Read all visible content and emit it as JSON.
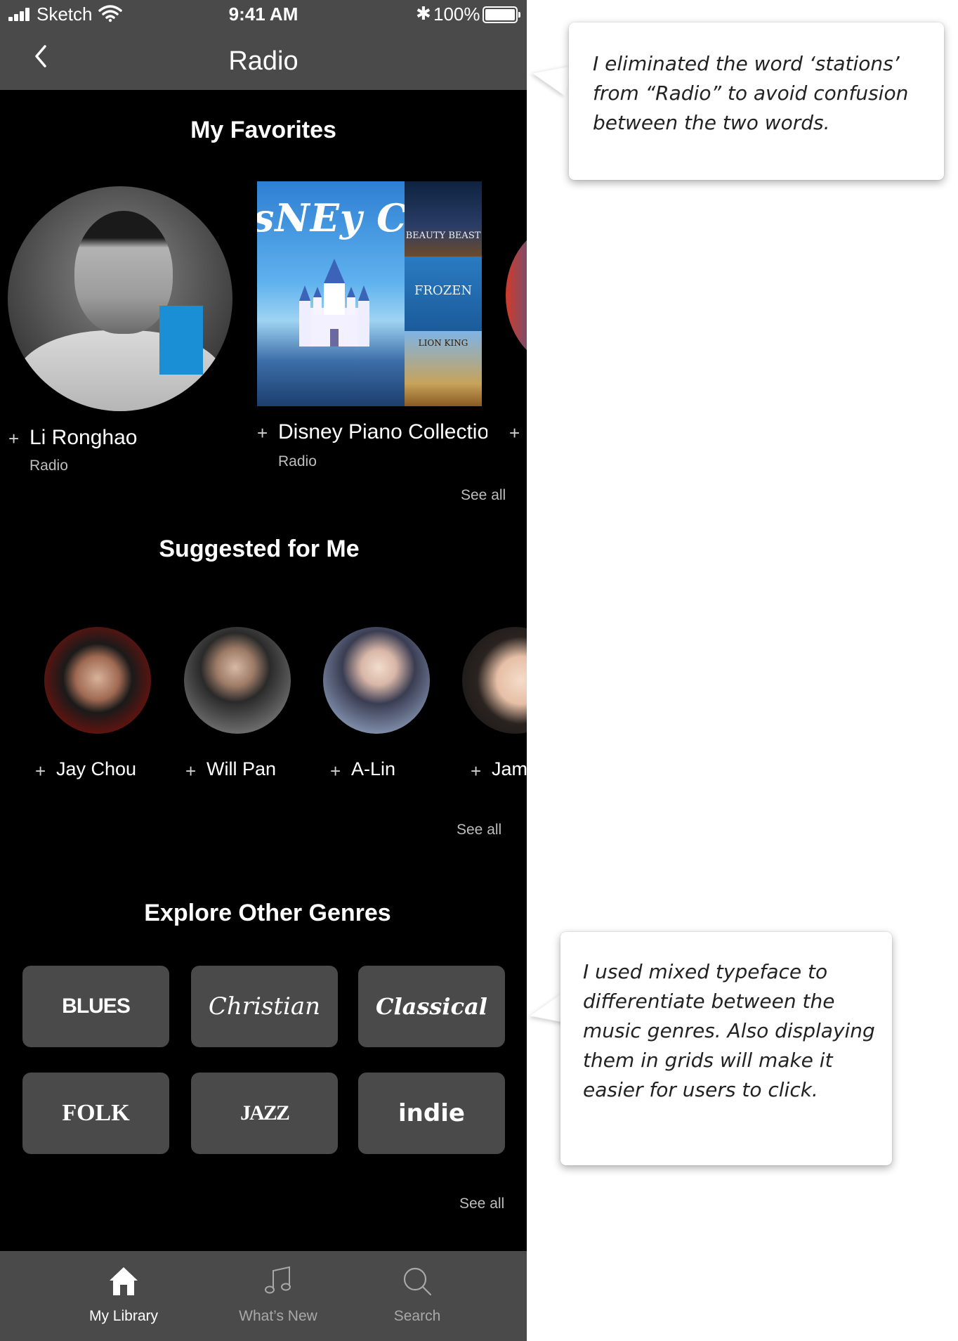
{
  "status_bar": {
    "carrier": "Sketch",
    "time": "9:41 AM",
    "battery": "100%"
  },
  "nav": {
    "title": "Radio"
  },
  "favorites": {
    "title": "My Favorites",
    "items": [
      {
        "name": "Li Ronghao",
        "subtitle": "Radio"
      },
      {
        "name": "Disney Piano Collection",
        "subtitle": "Radio"
      }
    ],
    "artwork_text": "sNEy CoLLE",
    "posters": [
      "BEAUTY BEAST",
      "FROZEN",
      "LION KING"
    ],
    "plus": "+",
    "see_all": "See all"
  },
  "suggested": {
    "title": "Suggested for Me",
    "items": [
      {
        "name": "Jay Chou"
      },
      {
        "name": "Will Pan"
      },
      {
        "name": "A-Lin"
      },
      {
        "name": "Jam"
      }
    ],
    "see_all": "See all"
  },
  "genres": {
    "title": "Explore Other Genres",
    "items": [
      "BLUES",
      "Christian",
      "Classical",
      "FOLK",
      "JAZZ",
      "indie"
    ],
    "see_all": "See all"
  },
  "tabs": [
    {
      "label": "My Library",
      "icon": "home-icon",
      "active": true
    },
    {
      "label": "What’s New",
      "icon": "music-note-icon",
      "active": false
    },
    {
      "label": "Search",
      "icon": "search-icon",
      "active": false
    }
  ],
  "annotations": [
    {
      "text": "I eliminated the word ‘stations’ from “Radio” to avoid confusion between the two words."
    },
    {
      "text": "I used mixed typeface to differentiate between the music genres. Also displaying them in grids will make it easier for users to click."
    }
  ],
  "colors": {
    "bar_bg": "#4a4a4a",
    "page_bg": "#000000",
    "tile_bg": "#4a4a4a",
    "muted_text": "#bdbdbd",
    "active_tab": "#ffffff",
    "inactive_tab": "#a8a8a8"
  }
}
